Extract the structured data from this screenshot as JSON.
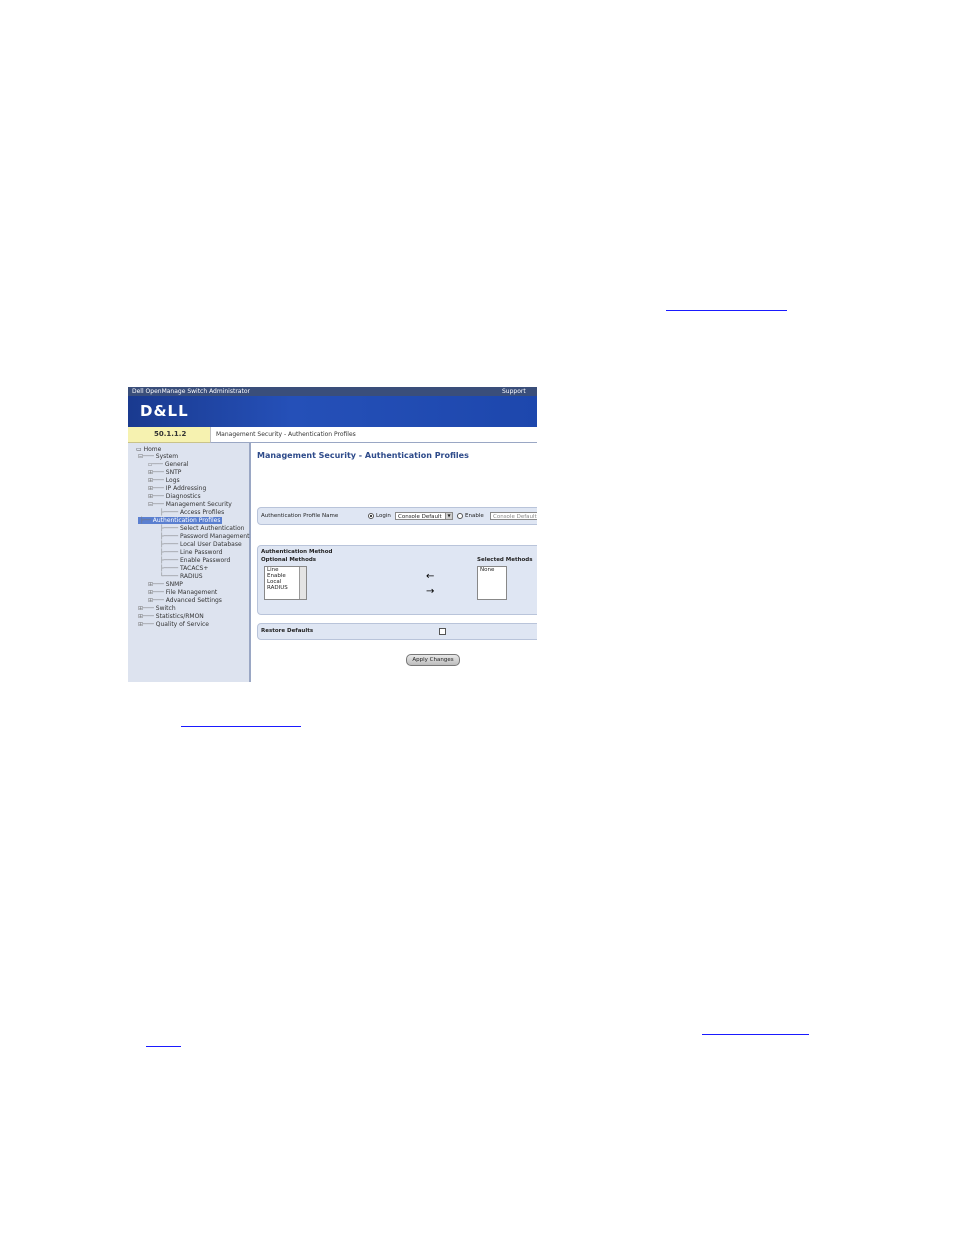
{
  "titlebar": {
    "title": "Dell OpenManage Switch Administrator",
    "support": "Support"
  },
  "logo": "D&LL",
  "ip": "50.1.1.2",
  "breadcrumb": "Management Security - Authentication Profiles",
  "tree": {
    "home": "Home",
    "system": "System",
    "items": [
      "General",
      "SNTP",
      "Logs",
      "IP Addressing",
      "Diagnostics",
      "Management Security",
      "Access Profiles",
      "Authentication Profiles",
      "Select Authentication",
      "Password Management",
      "Local User Database",
      "Line Password",
      "Enable Password",
      "TACACS+",
      "RADIUS",
      "SNMP",
      "File Management",
      "Advanced Settings",
      "Switch",
      "Statistics/RMON",
      "Quality of Service"
    ]
  },
  "page": {
    "title": "Management Security - Authentication Profiles",
    "profile_label": "Authentication Profile Name",
    "login_label": "Login",
    "login_value": "Console Default",
    "enable_label": "Enable",
    "enable_value": "Console Default",
    "method_section": "Authentication Method",
    "optional_label": "Optional Methods",
    "selected_label": "Selected Methods",
    "optional_methods": [
      "Line",
      "Enable",
      "Local",
      "RADIUS"
    ],
    "selected_methods": [
      "None"
    ],
    "restore_label": "Restore Defaults",
    "apply_label": "Apply Changes"
  }
}
